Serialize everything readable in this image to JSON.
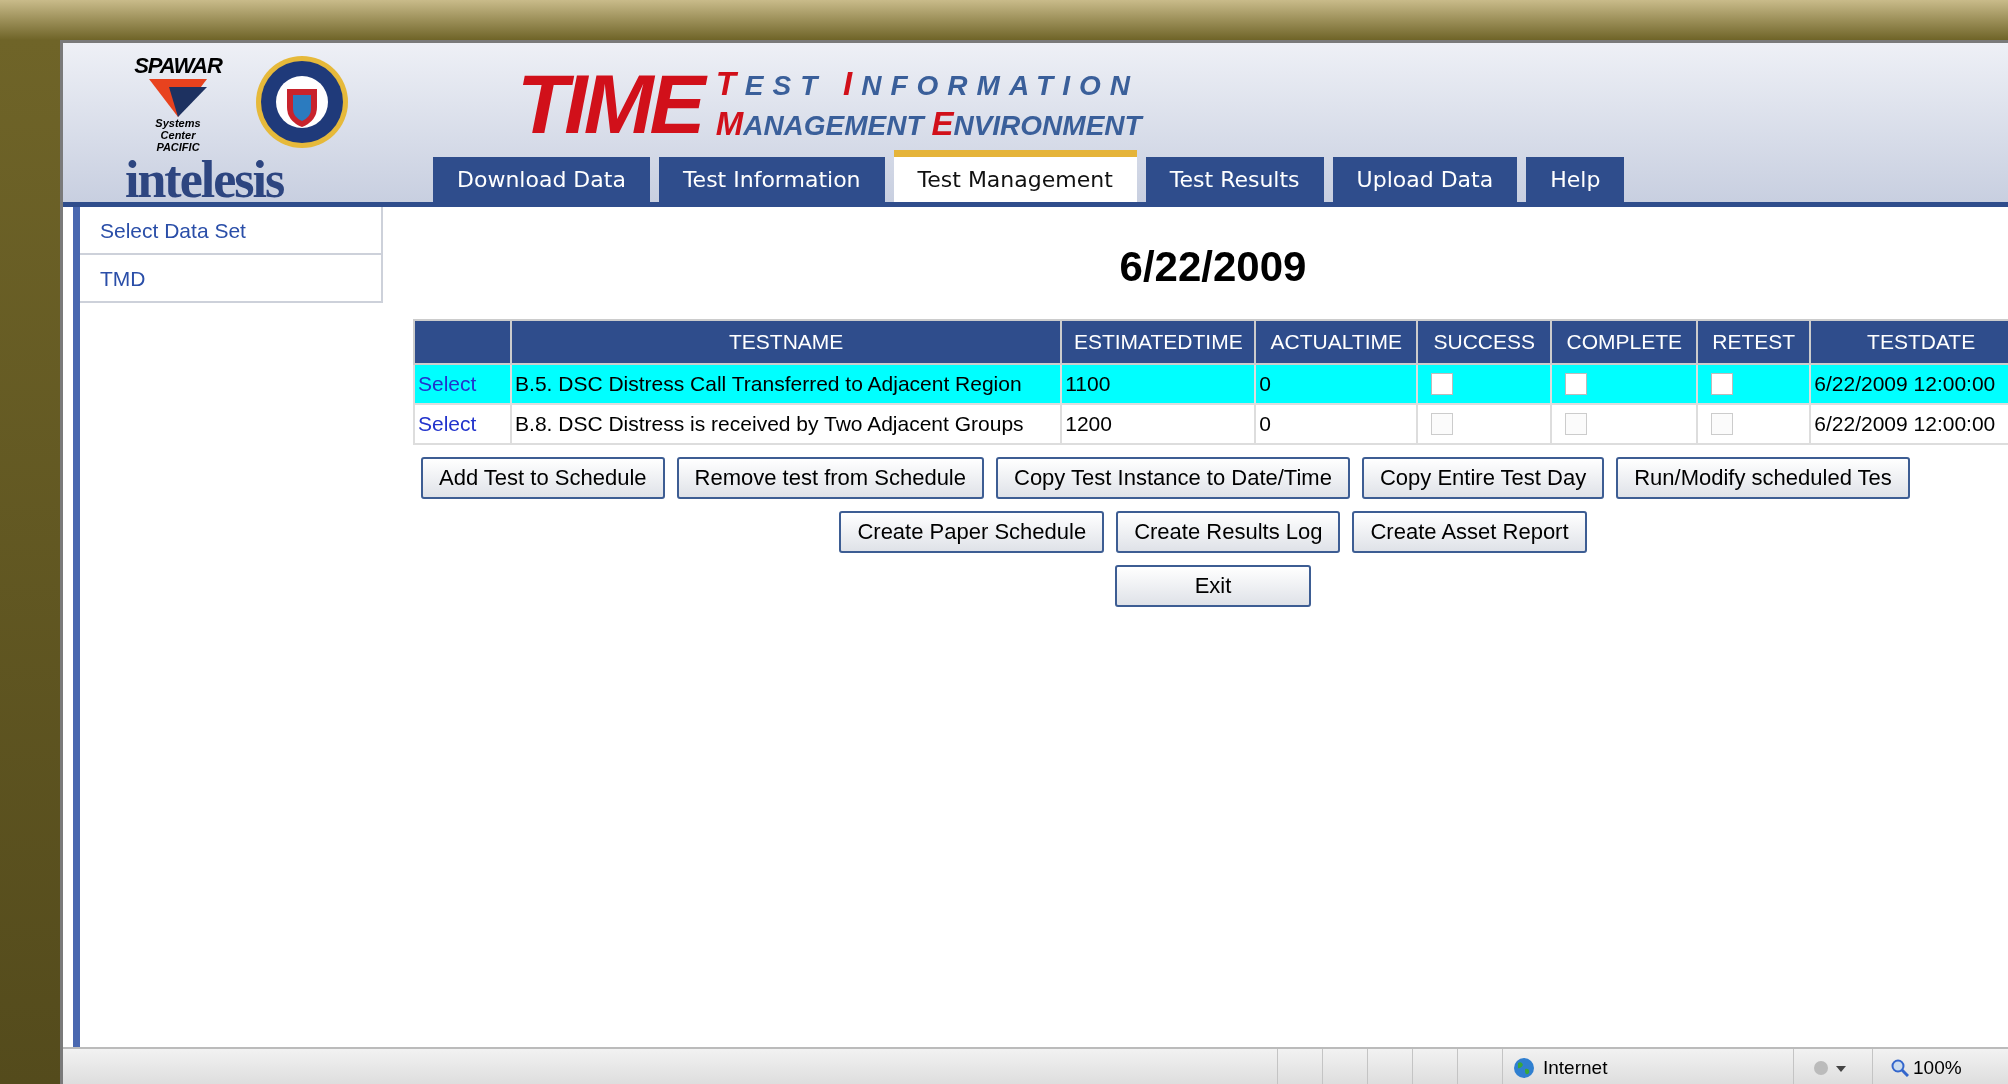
{
  "logo": {
    "org": "SPAWAR",
    "org_sub": "Systems Center PACIFIC",
    "company": "intelesis"
  },
  "app_title": {
    "name": "TIME",
    "line_1": "TEST INFORMATION",
    "line_2": "MANAGEMENT ENVIRONMENT"
  },
  "tabs": [
    {
      "label": "Download Data",
      "selected": false
    },
    {
      "label": "Test Information",
      "selected": false
    },
    {
      "label": "Test Management",
      "selected": true
    },
    {
      "label": "Test Results",
      "selected": false
    },
    {
      "label": "Upload Data",
      "selected": false
    },
    {
      "label": "Help",
      "selected": false
    }
  ],
  "sidebar": {
    "items": [
      {
        "label": "Select Data Set"
      },
      {
        "label": "TMD"
      }
    ]
  },
  "date": "6/22/2009",
  "table": {
    "columns": [
      "",
      "TESTNAME",
      "ESTIMATEDTIME",
      "ACTUALTIME",
      "SUCCESS",
      "COMPLETE",
      "RETEST",
      "TESTDATE"
    ],
    "rows": [
      {
        "link": "Select",
        "testname": "B.5. DSC Distress Call Transferred to Adjacent Region",
        "estimatedtime": "1100",
        "actualtime": "0",
        "success": false,
        "complete": false,
        "retest": false,
        "testdate": "6/22/2009 12:00:00",
        "selected": true
      },
      {
        "link": "Select",
        "testname": "B.8. DSC Distress is received by Two Adjacent Groups",
        "estimatedtime": "1200",
        "actualtime": "0",
        "success": false,
        "complete": false,
        "retest": false,
        "testdate": "6/22/2009 12:00:00",
        "selected": false
      }
    ]
  },
  "button_rows": [
    [
      "Add Test to Schedule",
      "Remove test from Schedule",
      "Copy Test Instance to Date/Time",
      "Copy Entire Test Day",
      "Run/Modify scheduled Tes"
    ],
    [
      "Create Paper Schedule",
      "Create Results Log",
      "Create Asset Report"
    ],
    [
      "Exit"
    ]
  ],
  "status_bar": {
    "zone": "Internet",
    "zoom": "100%"
  }
}
